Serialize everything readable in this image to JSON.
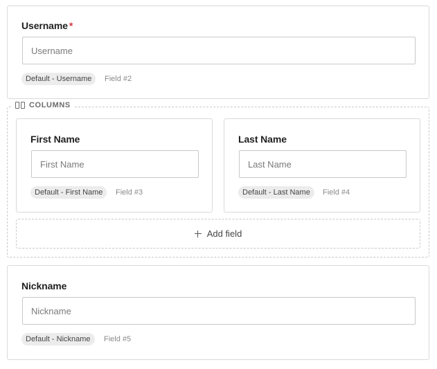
{
  "username_field": {
    "label": "Username",
    "required_mark": "*",
    "placeholder": "Username",
    "value": "",
    "tag": "Default - Username",
    "field_id": "Field #2"
  },
  "columns": {
    "legend": "COLUMNS",
    "icon": "columns-icon",
    "first_name_field": {
      "label": "First Name",
      "placeholder": "First Name",
      "value": "",
      "tag": "Default - First Name",
      "field_id": "Field #3"
    },
    "last_name_field": {
      "label": "Last Name",
      "placeholder": "Last Name",
      "value": "",
      "tag": "Default - Last Name",
      "field_id": "Field #4"
    },
    "add_field_label": "Add field",
    "add_field_icon": "plus-icon"
  },
  "nickname_field": {
    "label": "Nickname",
    "placeholder": "Nickname",
    "value": "",
    "tag": "Default - Nickname",
    "field_id": "Field #5"
  },
  "colors": {
    "required": "#d9363e",
    "border": "#d9d9d9",
    "tag_bg": "#ececec"
  }
}
